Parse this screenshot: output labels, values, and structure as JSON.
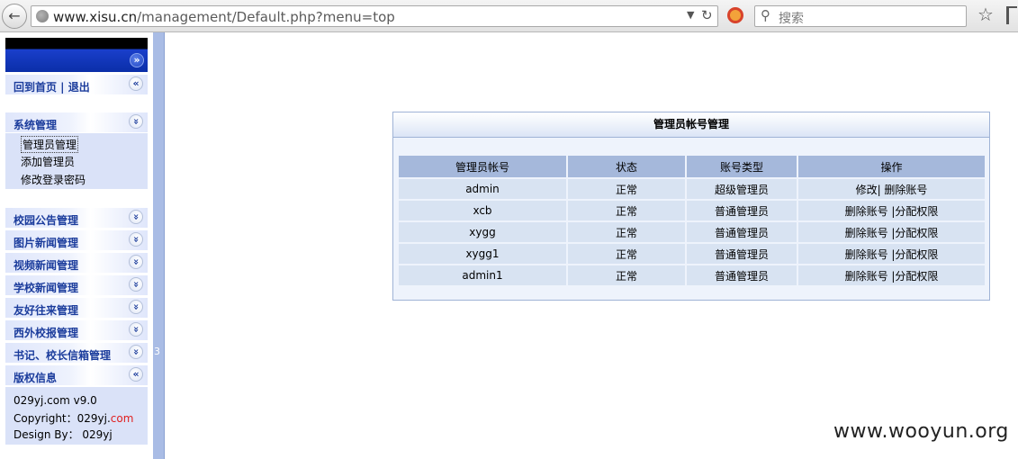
{
  "browser": {
    "url_host": "www.xisu.cn",
    "url_path": "/management/Default.php?menu=top",
    "search_placeholder": "搜索"
  },
  "sidebar": {
    "home_logout": "回到首页 | 退出",
    "system_menu": {
      "label": "系统管理",
      "items": [
        "管理员管理",
        "添加管理员",
        "修改登录密码"
      ]
    },
    "sections": [
      "校园公告管理",
      "图片新闻管理",
      "视频新闻管理",
      "学校新闻管理",
      "友好往来管理",
      "西外校报管理",
      "书记、校长信箱管理"
    ],
    "copyright_section": "版权信息",
    "copyright": {
      "version": "029yj.com v9.0",
      "copyright_prefix": "Copyright：029yj.",
      "copyright_suffix": "com",
      "design": "Design By： 029yj"
    },
    "divider_mark": "3"
  },
  "panel": {
    "title": "管理员帐号管理",
    "columns": [
      "管理员帐号",
      "状态",
      "账号类型",
      "操作"
    ],
    "rows": [
      {
        "account": "admin",
        "status": "正常",
        "type": "超级管理员",
        "action": "修改| 删除账号"
      },
      {
        "account": "xcb",
        "status": "正常",
        "type": "普通管理员",
        "action": "删除账号 |分配权限"
      },
      {
        "account": "xygg",
        "status": "正常",
        "type": "普通管理员",
        "action": "删除账号 |分配权限"
      },
      {
        "account": "xygg1",
        "status": "正常",
        "type": "普通管理员",
        "action": "删除账号 |分配权限"
      },
      {
        "account": "admin1",
        "status": "正常",
        "type": "普通管理员",
        "action": "删除账号 |分配权限"
      }
    ]
  },
  "watermark": "www.wooyun.org"
}
